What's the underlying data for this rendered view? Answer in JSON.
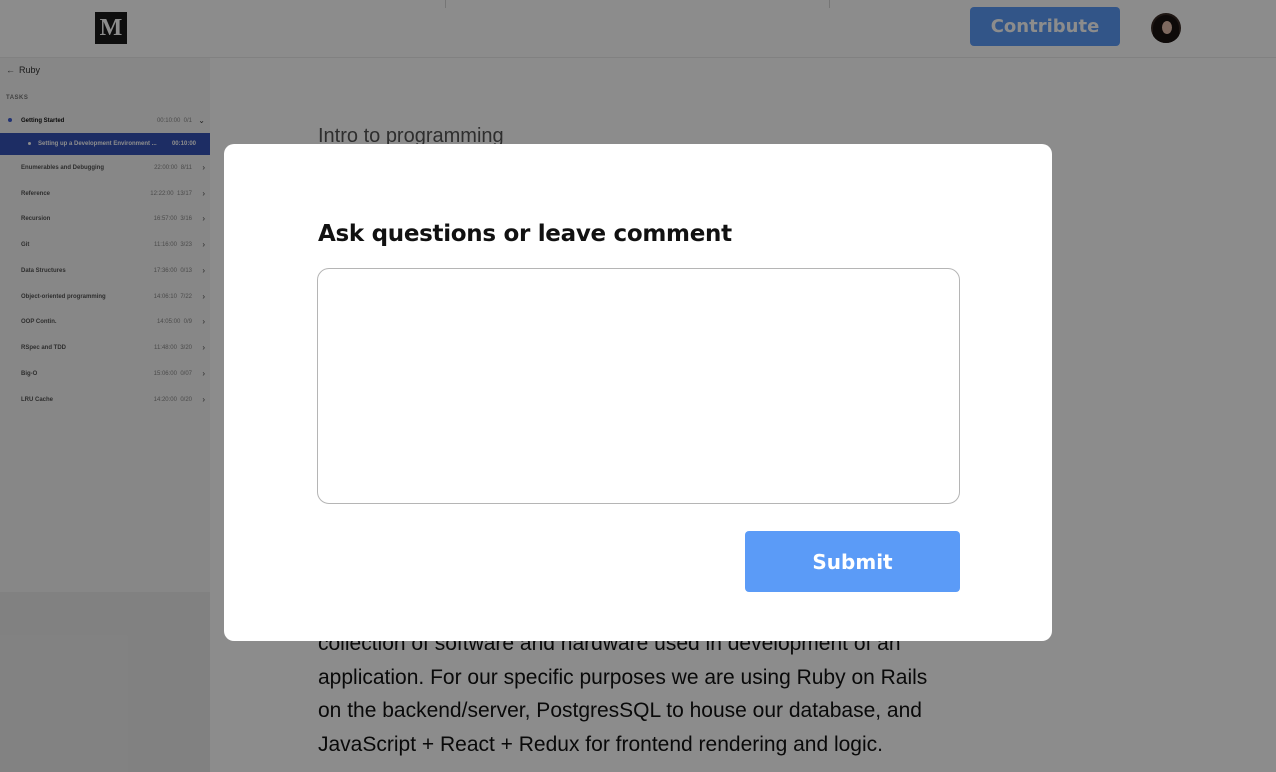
{
  "header": {
    "logo": "M",
    "contribute_label": "Contribute",
    "avatar_icon": "user-avatar"
  },
  "sidebar": {
    "back_label": "Ruby",
    "back_icon": "arrow-left-icon",
    "tasks_header": "TASKS",
    "tasks": [
      {
        "name": "Getting Started",
        "time": "00:10:00",
        "progress": "0/1",
        "expanded": true
      },
      {
        "name": "Enumerables and Debugging",
        "time": "22:00:00",
        "progress": "8/11"
      },
      {
        "name": "Reference",
        "time": "12:22:00",
        "progress": "13/17"
      },
      {
        "name": "Recursion",
        "time": "16:57:00",
        "progress": "3/16"
      },
      {
        "name": "Git",
        "time": "11:16:00",
        "progress": "3/23"
      },
      {
        "name": "Data Structures",
        "time": "17:36:00",
        "progress": "0/13"
      },
      {
        "name": "Object-oriented programming",
        "time": "14:06:10",
        "progress": "7/22"
      },
      {
        "name": "OOP Contin.",
        "time": "14:05:00",
        "progress": "0/9"
      },
      {
        "name": "RSpec and TDD",
        "time": "11:48:00",
        "progress": "3/20"
      },
      {
        "name": "Big-O",
        "time": "15:06:00",
        "progress": "0/07"
      },
      {
        "name": "LRU Cache",
        "time": "14:20:00",
        "progress": "0/20"
      }
    ],
    "subtask": {
      "name": "Setting up a Development Environment ...",
      "time": "00:10:00"
    }
  },
  "main": {
    "heading": "Intro to programming",
    "paragraph_lines": [
      "collection of software and hardware used in development of an",
      "application. For our specific purposes we are using Ruby on Rails",
      "on the backend/server, PostgresSQL to house our database, and",
      "JavaScript + React + Redux for frontend rendering and logic."
    ]
  },
  "modal": {
    "title": "Ask questions or leave comment",
    "textarea_value": "",
    "textarea_placeholder": "",
    "submit_label": "Submit"
  },
  "colors": {
    "accent": "#5b9bf7",
    "sidebar_active": "#3652b7"
  }
}
